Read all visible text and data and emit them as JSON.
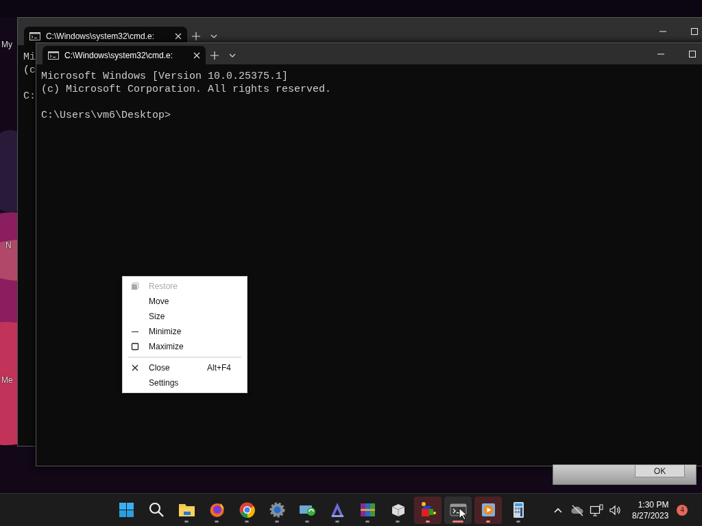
{
  "desktop": {
    "labels": [
      {
        "text": "My",
        "kind": "top"
      },
      {
        "text": "N",
        "kind": "middle"
      },
      {
        "text": "Me",
        "kind": "bottom"
      }
    ]
  },
  "back_window": {
    "tab_title": "C:\\Windows\\system32\\cmd.e:",
    "blocks": [
      [
        "Mi",
        "(c"
      ],
      [
        "C:"
      ]
    ]
  },
  "front_window": {
    "tab_title": "C:\\Windows\\system32\\cmd.e:",
    "blocks": [
      [
        "Microsoft Windows [Version 10.0.25375.1]",
        "(c) Microsoft Corporation. All rights reserved."
      ],
      [
        "C:\\Users\\vm6\\Desktop>"
      ]
    ]
  },
  "context_menu": {
    "items": [
      {
        "kind": "restore",
        "label": "Restore",
        "disabled": true
      },
      {
        "kind": "plain",
        "label": "Move",
        "disabled": false
      },
      {
        "kind": "plain",
        "label": "Size",
        "disabled": false
      },
      {
        "kind": "minimize",
        "label": "Minimize",
        "disabled": false
      },
      {
        "kind": "maximize",
        "label": "Maximize",
        "disabled": false
      },
      {
        "kind": "separator"
      },
      {
        "kind": "close",
        "label": "Close",
        "shortcut": "Alt+F4",
        "disabled": false
      },
      {
        "kind": "plain",
        "label": "Settings",
        "disabled": false
      }
    ]
  },
  "dialog": {
    "button": "OK"
  },
  "taskbar": {
    "apps": [
      {
        "kind": "start",
        "running": false,
        "flashing": false,
        "active": false
      },
      {
        "kind": "search",
        "running": false,
        "flashing": false,
        "active": false
      },
      {
        "kind": "folder",
        "running": true,
        "flashing": false,
        "active": false
      },
      {
        "kind": "firefox",
        "running": true,
        "flashing": false,
        "active": false
      },
      {
        "kind": "chrome",
        "running": true,
        "flashing": false,
        "active": false
      },
      {
        "kind": "settings",
        "running": true,
        "flashing": false,
        "active": false
      },
      {
        "kind": "remote",
        "running": true,
        "flashing": false,
        "active": false
      },
      {
        "kind": "vector",
        "running": true,
        "flashing": false,
        "active": false
      },
      {
        "kind": "archive",
        "running": true,
        "flashing": false,
        "active": false
      },
      {
        "kind": "dice",
        "running": true,
        "flashing": false,
        "active": false
      },
      {
        "kind": "cubes",
        "running": true,
        "flashing": true,
        "active": false
      },
      {
        "kind": "terminal",
        "running": true,
        "flashing": false,
        "active": true
      },
      {
        "kind": "media",
        "running": true,
        "flashing": true,
        "active": false
      },
      {
        "kind": "calculator",
        "running": true,
        "flashing": false,
        "active": false
      }
    ],
    "time": "1:30 PM",
    "date": "8/27/2023",
    "notification_count": "4"
  }
}
